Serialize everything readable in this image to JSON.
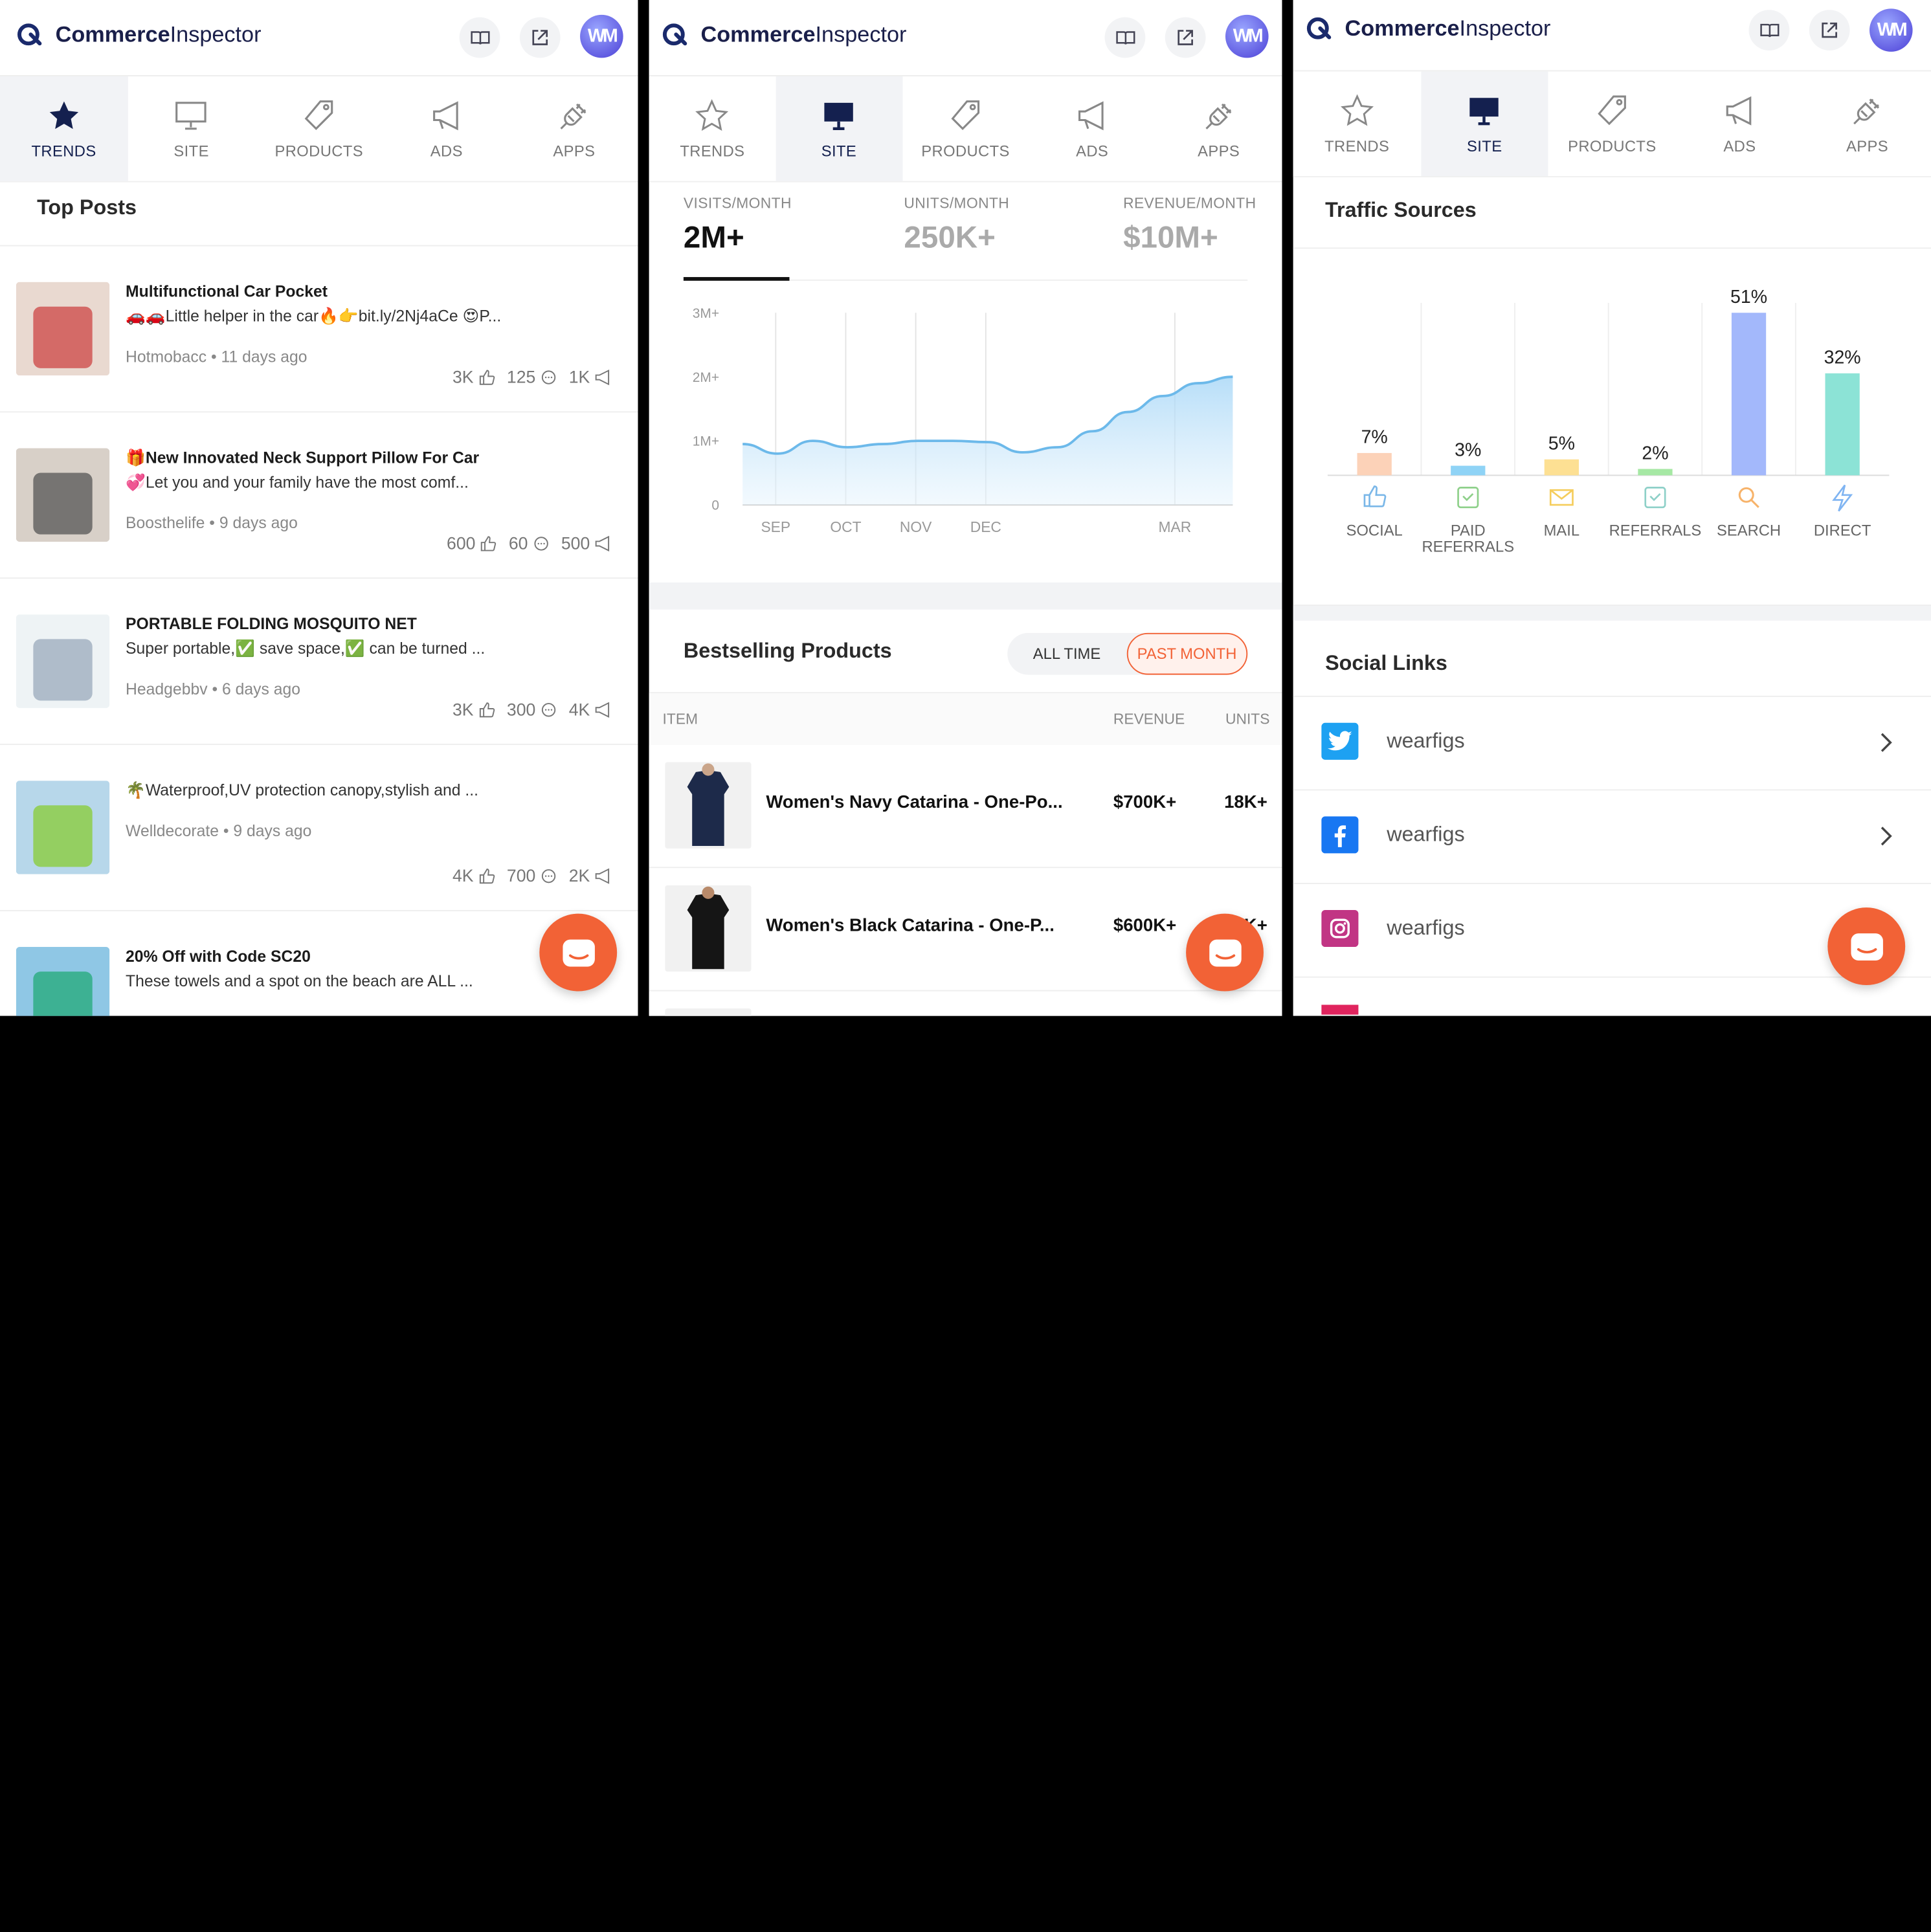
{
  "brand": {
    "name_bold": "Commerce",
    "name_regular": "Inspector",
    "avatar": "WM"
  },
  "tabs": [
    {
      "label": "TRENDS",
      "icon": "star-icon"
    },
    {
      "label": "SITE",
      "icon": "monitor-icon"
    },
    {
      "label": "PRODUCTS",
      "icon": "tag-icon"
    },
    {
      "label": "ADS",
      "icon": "megaphone-icon"
    },
    {
      "label": "APPS",
      "icon": "plug-icon"
    }
  ],
  "trends": {
    "section_title": "Top Posts",
    "posts": [
      {
        "title": "Multifunctional Car Pocket",
        "desc": "🚗🚗Little helper in the car🔥👉bit.ly/2Nj4aCe 😍P...",
        "author": "Hotmobacc",
        "age": "11 days ago",
        "likes": "3K",
        "comments": "125",
        "shares": "1K"
      },
      {
        "title": "🎁New Innovated Neck Support Pillow For Car",
        "desc": "💞Let you and your family have the most comf...",
        "author": "Boosthelife",
        "age": "9 days ago",
        "likes": "600",
        "comments": "60",
        "shares": "500"
      },
      {
        "title": "PORTABLE FOLDING MOSQUITO NET",
        "desc": "Super portable,✅ save space,✅ can be turned ...",
        "author": "Headgebbv",
        "age": "6 days ago",
        "likes": "3K",
        "comments": "300",
        "shares": "4K"
      },
      {
        "title": "",
        "desc": "🌴Waterproof,UV protection canopy,stylish and ...",
        "author": "Welldecorate",
        "age": "9 days ago",
        "likes": "4K",
        "comments": "700",
        "shares": "2K"
      },
      {
        "title": "20% Off with Code SC20",
        "desc": "These towels and a spot on the beach are ALL ...",
        "author": "",
        "age": "",
        "likes": "",
        "comments": "",
        "shares": ""
      }
    ]
  },
  "site": {
    "metrics": [
      {
        "label": "VISITS/MONTH",
        "value": "2M+"
      },
      {
        "label": "UNITS/MONTH",
        "value": "250K+"
      },
      {
        "label": "REVENUE/MONTH",
        "value": "$10M+"
      }
    ],
    "bestselling_title": "Bestselling Products",
    "filter": {
      "all": "ALL TIME",
      "past": "PAST MONTH"
    },
    "table_headers": {
      "item": "ITEM",
      "revenue": "REVENUE",
      "units": "UNITS"
    },
    "products": [
      {
        "name": "Women's Navy Catarina - One-Po...",
        "revenue": "$700K+",
        "units": "18K+"
      },
      {
        "name": "Women's Black Catarina - One-P...",
        "revenue": "$600K+",
        "units": "18K+"
      }
    ]
  },
  "traffic": {
    "section_title": "Traffic Sources",
    "social_title": "Social Links",
    "social": [
      {
        "network": "twitter",
        "handle": "wearfigs",
        "color": "#1da1f2"
      },
      {
        "network": "facebook",
        "handle": "wearfigs",
        "color": "#1877f2"
      },
      {
        "network": "instagram",
        "handle": "wearfigs",
        "color": "#c13584"
      }
    ]
  },
  "chart_data": [
    {
      "type": "area",
      "title": "",
      "y_ticks": [
        "3M+",
        "2M+",
        "1M+",
        "0"
      ],
      "x_ticks": [
        "SEP",
        "OCT",
        "NOV",
        "DEC",
        "MAR"
      ],
      "ylim": [
        0,
        3000000
      ],
      "x": [
        0,
        0.5,
        1,
        1.5,
        2,
        2.5,
        3,
        3.5,
        4,
        4.5,
        5,
        5.5,
        6,
        6.5,
        7
      ],
      "values": [
        950000,
        800000,
        1000000,
        900000,
        950000,
        1000000,
        1000000,
        980000,
        820000,
        900000,
        1150000,
        1450000,
        1700000,
        1900000,
        2000000
      ],
      "color": "#6cb9ea"
    },
    {
      "type": "bar",
      "title": "Traffic Sources",
      "categories": [
        "SOCIAL",
        "PAID REFERRALS",
        "MAIL",
        "REFERRALS",
        "SEARCH",
        "DIRECT"
      ],
      "values": [
        7,
        3,
        5,
        2,
        51,
        32
      ],
      "labels": [
        "7%",
        "3%",
        "5%",
        "2%",
        "51%",
        "32%"
      ],
      "colors": [
        "#fcd2b8",
        "#8fd3f6",
        "#fde093",
        "#a6e8a4",
        "#a3b8fb",
        "#8ce3d6"
      ],
      "icons": [
        "thumbs-up-icon",
        "paid-referral-icon",
        "mail-icon",
        "referral-icon",
        "search-icon",
        "lightning-icon"
      ],
      "ylim": [
        0,
        51
      ]
    }
  ]
}
